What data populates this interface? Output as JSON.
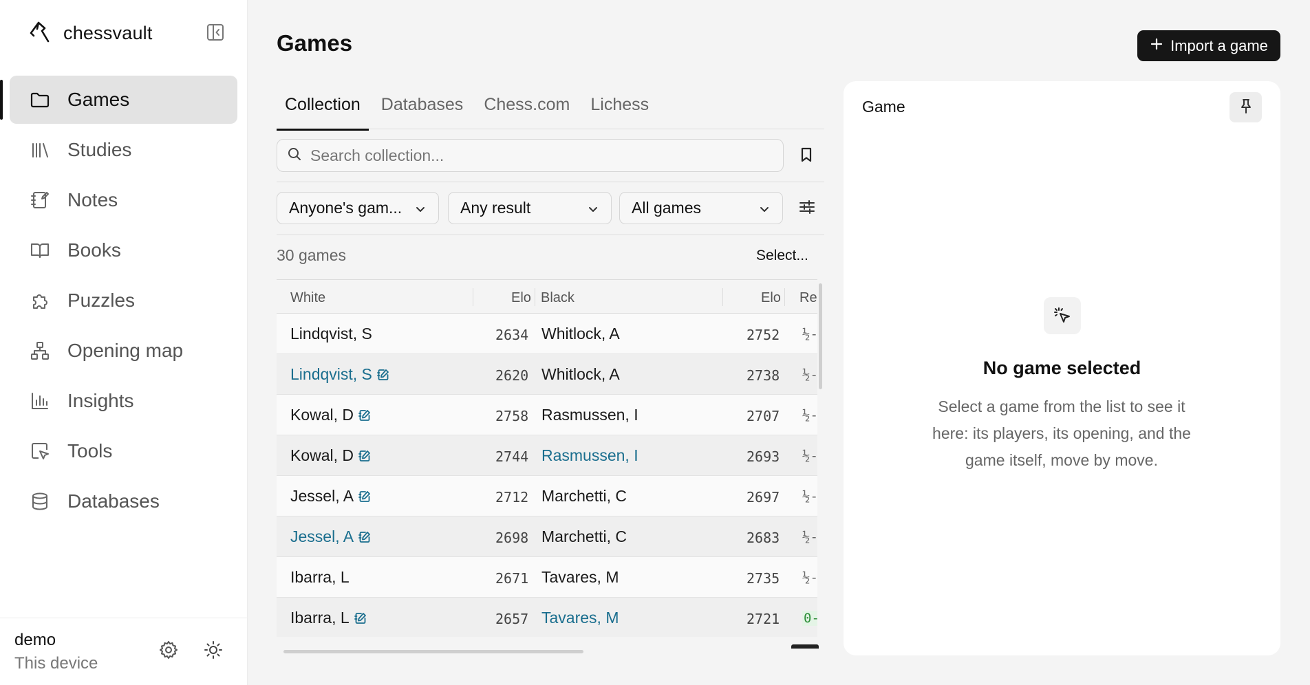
{
  "app": {
    "name": "chessvault"
  },
  "sidebar": {
    "items": [
      {
        "label": "Games",
        "icon": "folder-icon",
        "active": true
      },
      {
        "label": "Studies",
        "icon": "library-icon",
        "active": false
      },
      {
        "label": "Notes",
        "icon": "notebook-icon",
        "active": false
      },
      {
        "label": "Books",
        "icon": "book-icon",
        "active": false
      },
      {
        "label": "Puzzles",
        "icon": "puzzle-icon",
        "active": false
      },
      {
        "label": "Opening map",
        "icon": "network-icon",
        "active": false
      },
      {
        "label": "Insights",
        "icon": "bar-chart-icon",
        "active": false
      },
      {
        "label": "Tools",
        "icon": "cursor-square-icon",
        "active": false
      },
      {
        "label": "Databases",
        "icon": "database-icon",
        "active": false
      }
    ],
    "footer": {
      "user": "demo",
      "device": "This device"
    }
  },
  "main": {
    "title": "Games",
    "import_label": "Import a game",
    "tabs": [
      {
        "label": "Collection",
        "active": true
      },
      {
        "label": "Databases",
        "active": false
      },
      {
        "label": "Chess.com",
        "active": false
      },
      {
        "label": "Lichess",
        "active": false
      }
    ],
    "search": {
      "placeholder": "Search collection...",
      "value": ""
    },
    "filters": {
      "player": "Anyone's gam...",
      "result": "Any result",
      "scope": "All games"
    },
    "games_count": "30 games",
    "select_label": "Select...",
    "table": {
      "headers": {
        "white": "White",
        "white_elo": "Elo",
        "black": "Black",
        "black_elo": "Elo",
        "result": "Re"
      },
      "rows": [
        {
          "white": "Lindqvist, S",
          "white_note": false,
          "white_linked": false,
          "white_elo": "2634",
          "black": "Whitlock, A",
          "black_linked": false,
          "black_elo": "2752",
          "result": "½-"
        },
        {
          "white": "Lindqvist, S",
          "white_note": true,
          "white_linked": true,
          "white_elo": "2620",
          "black": "Whitlock, A",
          "black_linked": false,
          "black_elo": "2738",
          "result": "½-"
        },
        {
          "white": "Kowal, D",
          "white_note": true,
          "white_linked": false,
          "white_elo": "2758",
          "black": "Rasmussen, I",
          "black_linked": false,
          "black_elo": "2707",
          "result": "½-"
        },
        {
          "white": "Kowal, D",
          "white_note": true,
          "white_linked": false,
          "white_elo": "2744",
          "black": "Rasmussen, I",
          "black_linked": true,
          "black_elo": "2693",
          "result": "½-"
        },
        {
          "white": "Jessel, A",
          "white_note": true,
          "white_linked": false,
          "white_elo": "2712",
          "black": "Marchetti, C",
          "black_linked": false,
          "black_elo": "2697",
          "result": "½-"
        },
        {
          "white": "Jessel, A",
          "white_note": true,
          "white_linked": true,
          "white_elo": "2698",
          "black": "Marchetti, C",
          "black_linked": false,
          "black_elo": "2683",
          "result": "½-"
        },
        {
          "white": "Ibarra, L",
          "white_note": false,
          "white_linked": false,
          "white_elo": "2671",
          "black": "Tavares, M",
          "black_linked": false,
          "black_elo": "2735",
          "result": "½-"
        },
        {
          "white": "Ibarra, L",
          "white_note": true,
          "white_linked": false,
          "white_elo": "2657",
          "black": "Tavares, M",
          "black_linked": true,
          "black_elo": "2721",
          "result": "0-"
        }
      ]
    }
  },
  "panel": {
    "title": "Game",
    "empty_title": "No game selected",
    "empty_desc": "Select a game from the list to see it here: its players, its opening, and the game itself, move by move."
  },
  "colors": {
    "accent": "#161616",
    "link": "#1a6e8e",
    "active_nav": "#e3e3e3",
    "win": "#2f8f3a"
  }
}
